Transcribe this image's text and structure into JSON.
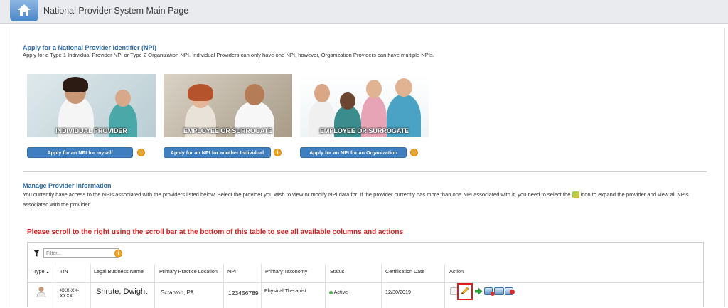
{
  "header": {
    "title": "National Provider System Main Page"
  },
  "apply": {
    "title": "Apply for a National Provider Identifier (NPI)",
    "desc": "Apply for a Type 1 Individual Provider NPI or Type 2 Organization NPI. Individual Providers can only have one NPI, however, Organization Providers can have multiple NPIs.",
    "cards": [
      {
        "caption": "INDIVIDUAL PROVIDER",
        "button": "Apply for an NPI for myself"
      },
      {
        "caption": "EMPLOYEE OR SURROGATE",
        "button": "Apply for an NPI for another Individual"
      },
      {
        "caption": "EMPLOYEE OR SURROGATE",
        "button": "Apply for an NPI for an Organization"
      }
    ]
  },
  "manage": {
    "title": "Manage Provider Information",
    "desc_part1": "You currently have access to the NPIs associated with the providers listed below. Select the provider you wish to view or modify NPI data for. If the provider currently has more than one NPI associated with it, you need to select the",
    "desc_part2": "icon to expand the provider and view all NPIs associated with the provider.",
    "warning": "Please scroll to the right using the scroll bar at the bottom of this table to see all available columns and actions"
  },
  "table": {
    "filter_placeholder": "Filter...",
    "columns": [
      "Type",
      "TIN",
      "Legal Business Name",
      "Primary Practice Location",
      "NPI",
      "Primary Taxonomy",
      "Status",
      "Certification Date",
      "Action"
    ],
    "sort_indicator": "▲",
    "rows": [
      {
        "tin": "XXX-XX- XXXX",
        "name": "Shrute, Dwight",
        "location": "Scranton, PA",
        "npi": "123456789",
        "taxonomy": "Physical Therapist",
        "status": "Active",
        "cert_date": "12/30/2019"
      }
    ]
  },
  "colors": {
    "accent": "#2f6da7",
    "button": "#3f7fc0",
    "warning": "#d41f1f",
    "info": "#f0a42a",
    "active": "#4caf50"
  }
}
